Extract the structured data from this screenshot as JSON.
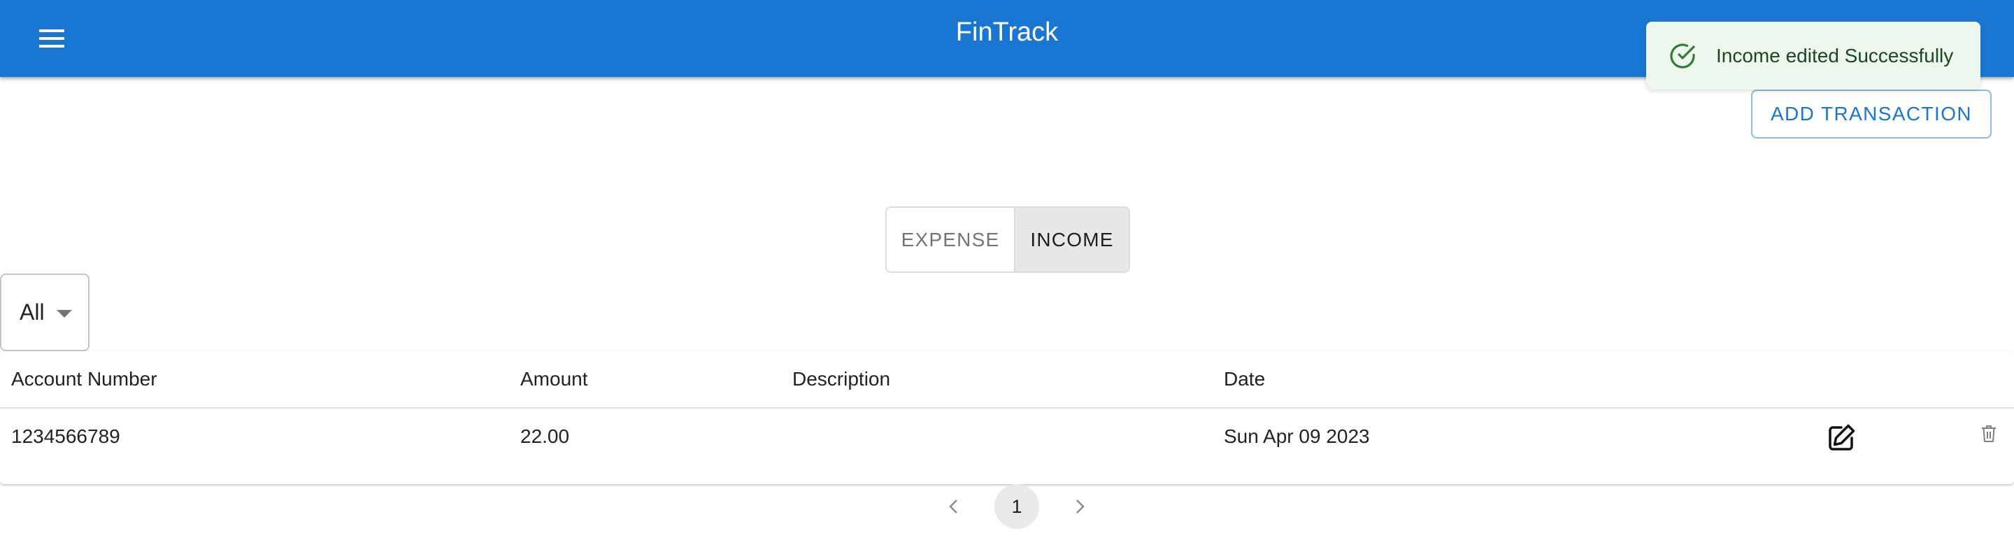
{
  "app": {
    "title": "FinTrack"
  },
  "header": {
    "menu_icon": "hamburger-menu-icon"
  },
  "toast": {
    "message": "Income edited Successfully",
    "icon": "check-circle-icon",
    "color": "#2e7d32"
  },
  "actions": {
    "add_transaction_label": "ADD TRANSACTION"
  },
  "type_toggle": {
    "options": [
      {
        "label": "EXPENSE",
        "selected": false
      },
      {
        "label": "INCOME",
        "selected": true
      }
    ]
  },
  "filter": {
    "value": "All"
  },
  "table": {
    "columns": [
      "Account Number",
      "Amount",
      "Description",
      "Date"
    ],
    "rows": [
      {
        "account_number": "1234566789",
        "amount": "22.00",
        "description": "",
        "date": "Sun Apr 09 2023",
        "edit_icon": "edit-icon",
        "delete_icon": "trash-icon"
      }
    ]
  },
  "pagination": {
    "current_page": "1",
    "prev_icon": "chevron-left-icon",
    "next_icon": "chevron-right-icon"
  },
  "colors": {
    "primary": "#1976d2",
    "toast_bg": "#edf7ed",
    "toast_text": "#1e4620"
  }
}
